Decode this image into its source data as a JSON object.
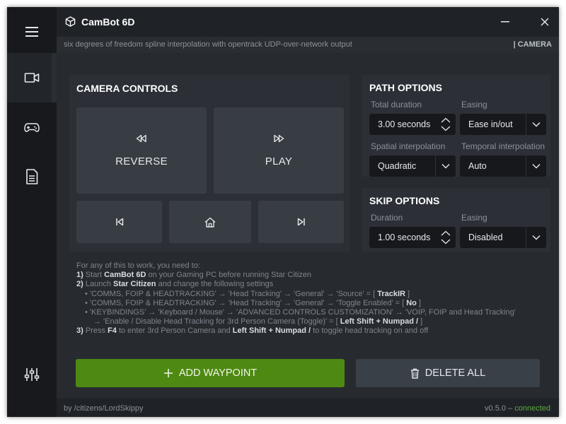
{
  "window": {
    "title": "CamBot 6D",
    "subtitle": "six degrees of freedom spline interpolation with opentrack UDP-over-network output",
    "section": "| CAMERA"
  },
  "sidebar": {
    "items": [
      {
        "icon": "hamburger-menu-icon"
      },
      {
        "icon": "camera-icon"
      },
      {
        "icon": "gamepad-icon"
      },
      {
        "icon": "document-icon"
      },
      {
        "icon": "sliders-icon"
      }
    ]
  },
  "camera_controls": {
    "title": "CAMERA CONTROLS",
    "reverse_label": "REVERSE",
    "play_label": "PLAY"
  },
  "path_options": {
    "title": "PATH OPTIONS",
    "total_duration_label": "Total duration",
    "total_duration_value": "3.00 seconds",
    "easing_label": "Easing",
    "easing_value": "Ease in/out",
    "spatial_label": "Spatial interpolation",
    "spatial_value": "Quadratic",
    "temporal_label": "Temporal interpolation",
    "temporal_value": "Auto"
  },
  "skip_options": {
    "title": "SKIP OPTIONS",
    "duration_label": "Duration",
    "duration_value": "1.00 seconds",
    "easing_label": "Easing",
    "easing_value": "Disabled"
  },
  "instructions": {
    "intro": "For any of this to work, you need to:",
    "s1_num": "1)",
    "s1_a": "Start",
    "s1_b": "CamBot 6D",
    "s1_c": "on your Gaming PC before running Star Citizen",
    "s2_num": "2)",
    "s2_a": "Launch",
    "s2_b": "Star Citizen",
    "s2_c": "and change the following settings",
    "b1_a": "• 'COMMS, FOIP & HEADTRACKING' → 'Head Tracking' → 'General' → 'Source' = [",
    "b1_b": "TrackIR",
    "b1_c": "]",
    "b2_a": "• 'COMMS, FOIP & HEADTRACKING' → 'Head Tracking' → 'General' → 'Toggle Enabled' = [",
    "b2_b": "No",
    "b2_c": "]",
    "b3_a": "• 'KEYBINDINGS' → 'Keyboard / Mouse' → 'ADVANCED CONTROLS CUSTOMIZATION' → 'VOIP, FOIP and Head Tracking'",
    "b3_d": "→ 'Enable / Disable Head Tracking for 3rd Person Camera (Toggle)' = [",
    "b3_e": "Left Shift + Numpad /",
    "b3_f": "]",
    "s3_num": "3)",
    "s3_a": "Press",
    "s3_b": "F4",
    "s3_c": "to enter 3rd Person Camera and",
    "s3_d": "Left Shift + Numpad /",
    "s3_e": "to toggle head tracking on and off"
  },
  "actions": {
    "add_waypoint": "ADD WAYPOINT",
    "delete_all": "DELETE ALL"
  },
  "footer": {
    "credit": "by /citizens/LordSkippy",
    "version": "v0.5.0 –",
    "status": "connected"
  },
  "colors": {
    "accent_green": "#4e8a12",
    "connected": "#5fa83a"
  }
}
